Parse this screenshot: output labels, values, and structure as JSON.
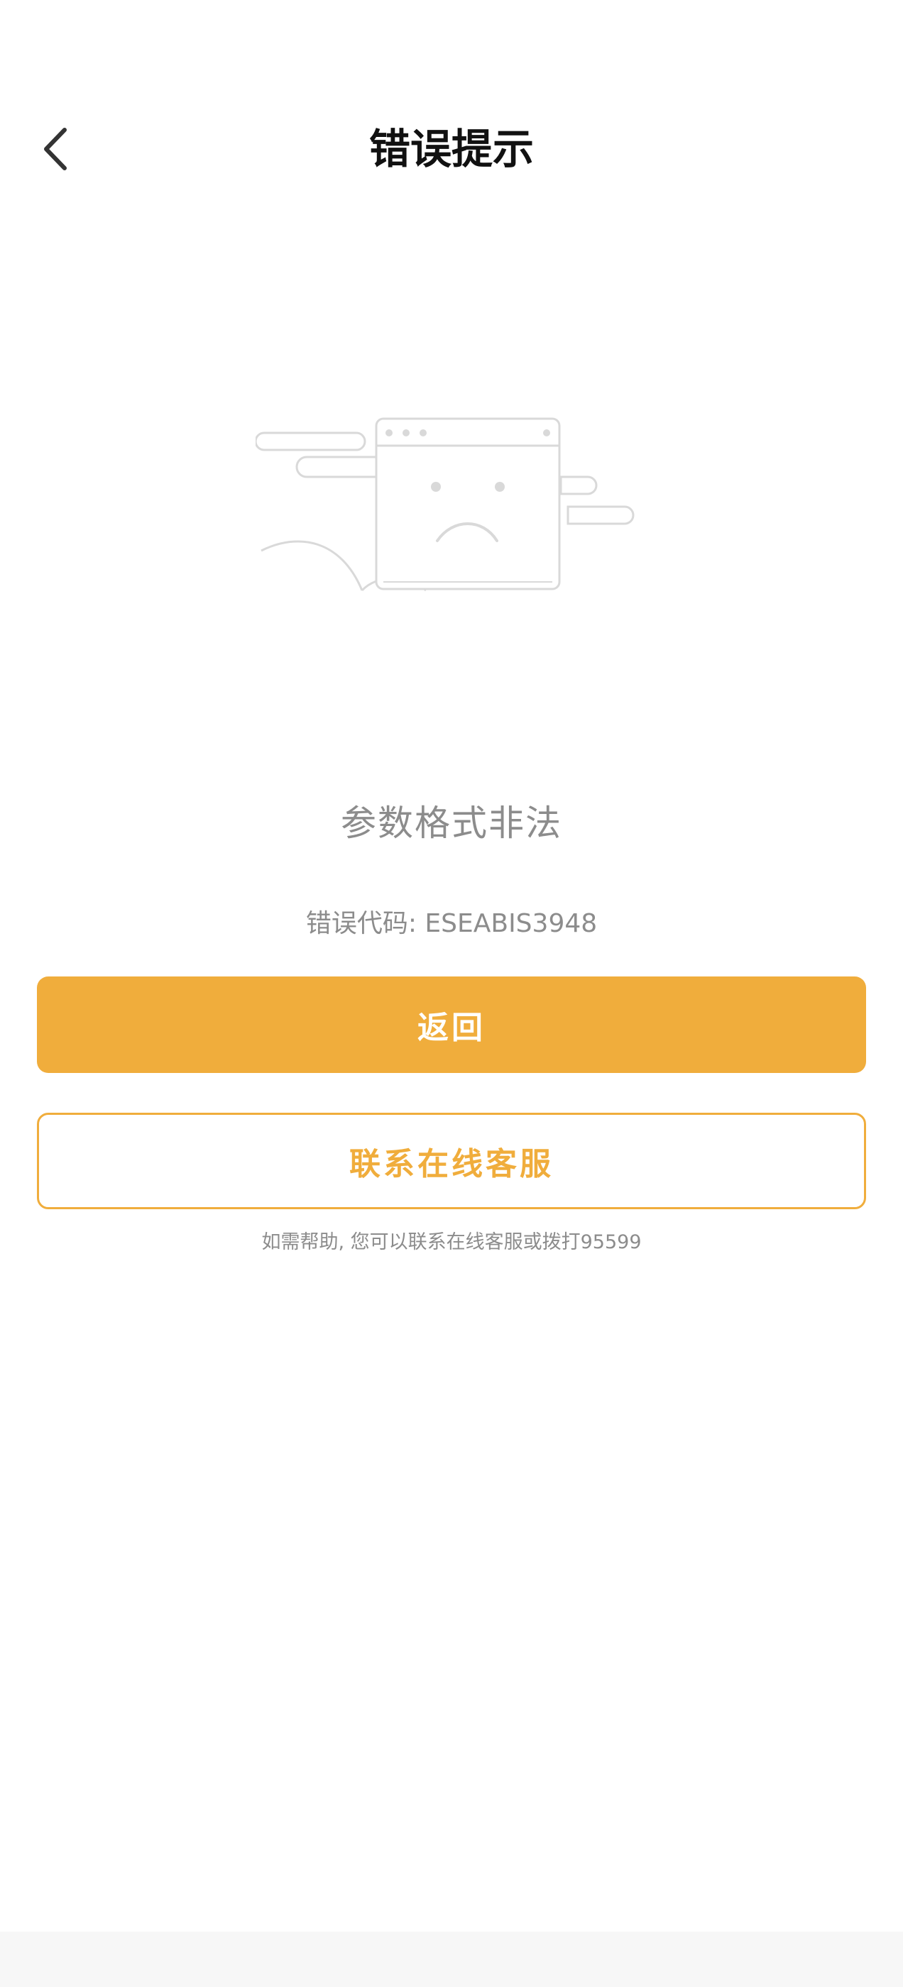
{
  "header": {
    "title": "错误提示",
    "back_icon": "chevron-left-icon"
  },
  "illustration": {
    "icon": "sad-browser-window-icon",
    "color": "#d9d9d9"
  },
  "error": {
    "message": "参数格式非法",
    "code_text": "错误代码: ESEABIS3948"
  },
  "buttons": {
    "back_label": "返回",
    "contact_label": "联系在线客服"
  },
  "help": {
    "text": "如需帮助, 您可以联系在线客服或拨打95599"
  },
  "colors": {
    "accent": "#f0ad3c",
    "muted_text": "#8c8c8c",
    "title_text": "#111111"
  }
}
